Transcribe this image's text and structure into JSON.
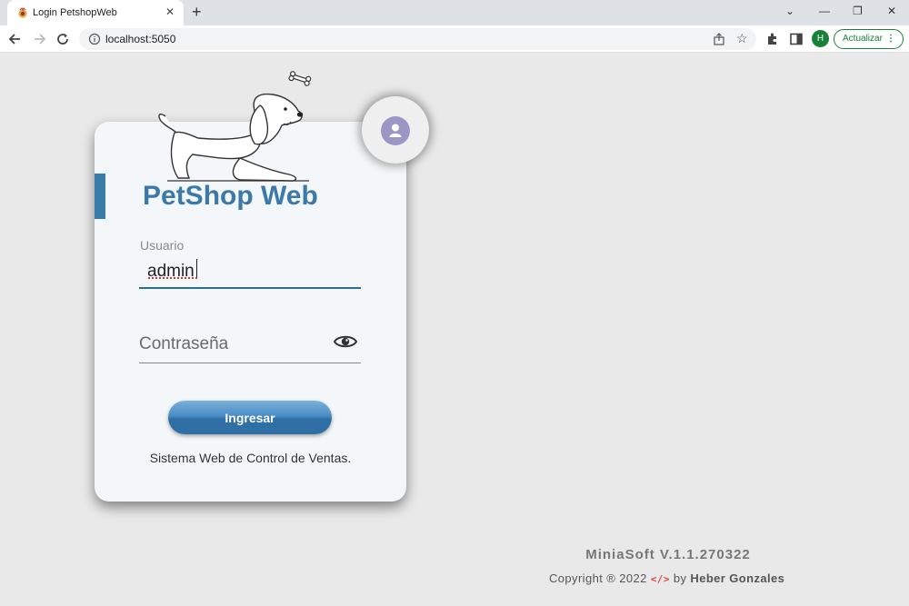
{
  "browser": {
    "tab_title": "Login PetshopWeb",
    "tab_close": "✕",
    "new_tab": "+",
    "url": "localhost:5050",
    "profile_initial": "H",
    "update_label": "Actualizar",
    "window_controls": {
      "collapse": "⌄",
      "minimize": "—",
      "restore": "❐",
      "close": "✕"
    }
  },
  "login": {
    "brand": "PetShop Web",
    "username_label": "Usuario",
    "username_value": "admin",
    "password_placeholder": "Contraseña",
    "submit_label": "Ingresar",
    "tagline": "Sistema Web de Control de Ventas."
  },
  "footer": {
    "version": "MiniaSoft V.1.1.270322",
    "copyright_prefix": "Copyright ® 2022",
    "code_symbol": "</>",
    "by": "by",
    "author": "Heber Gonzales"
  },
  "colors": {
    "brand": "#3b7aa8",
    "accent": "#3a7ca8",
    "button": "#2f6fa6",
    "page_bg": "#e9e9e9",
    "card_bg": "#f4f7f9"
  },
  "icons": [
    "favicon-icon",
    "back-arrow-icon",
    "forward-arrow-icon",
    "reload-icon",
    "info-icon",
    "share-icon",
    "star-icon",
    "extensions-icon",
    "sidepanel-icon",
    "user-avatar-icon",
    "eye-icon",
    "bone-icon",
    "dog-illustration"
  ]
}
